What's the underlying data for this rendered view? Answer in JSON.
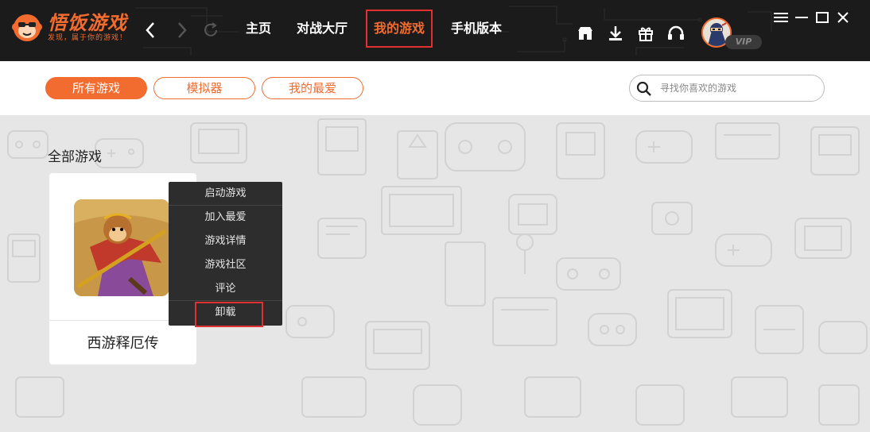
{
  "app": {
    "title": "悟饭游戏",
    "slogan": "发现，属于你的游戏！",
    "brand_color": "#f26b2f",
    "highlight_color": "#e03030"
  },
  "topnav": {
    "items": [
      {
        "label": "主页"
      },
      {
        "label": "对战大厅"
      },
      {
        "label": "我的游戏",
        "active": true
      },
      {
        "label": "手机版本"
      }
    ]
  },
  "title_icons": [
    "store-icon",
    "download-icon",
    "gift-icon",
    "headset-icon"
  ],
  "user": {
    "vip_label": "VIP"
  },
  "filters": {
    "items": [
      {
        "label": "所有游戏",
        "active": true
      },
      {
        "label": "模拟器"
      },
      {
        "label": "我的最爱"
      }
    ]
  },
  "search": {
    "placeholder": "寻找你喜欢的游戏",
    "value": ""
  },
  "main": {
    "section_title": "全部游戏",
    "games": [
      {
        "name": "西游释厄传"
      }
    ]
  },
  "context_menu": {
    "items": [
      {
        "label": "启动游戏"
      },
      {
        "label": "加入最爱"
      },
      {
        "label": "游戏详情"
      },
      {
        "label": "游戏社区"
      },
      {
        "label": "评论"
      },
      {
        "label": "卸载",
        "highlighted": true
      }
    ]
  }
}
